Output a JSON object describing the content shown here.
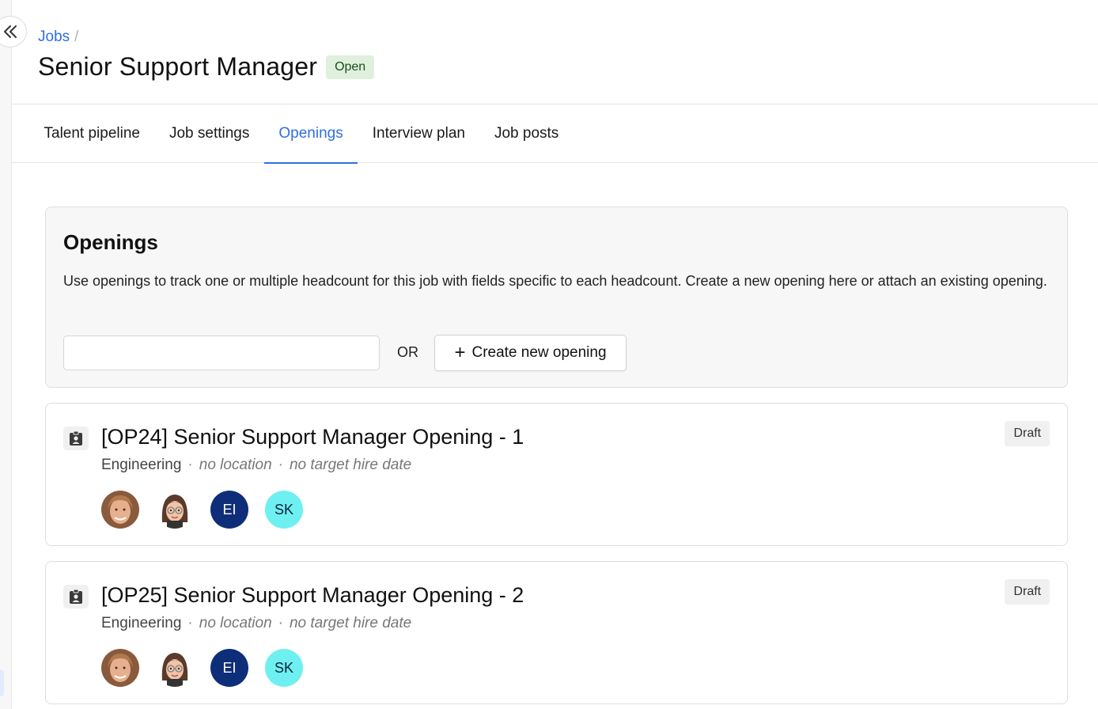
{
  "breadcrumb": {
    "jobs_link": "Jobs",
    "separator": "/"
  },
  "job": {
    "title": "Senior Support Manager",
    "status": "Open"
  },
  "tabs": [
    {
      "label": "Talent pipeline",
      "active": false
    },
    {
      "label": "Job settings",
      "active": false
    },
    {
      "label": "Openings",
      "active": true
    },
    {
      "label": "Interview plan",
      "active": false
    },
    {
      "label": "Job posts",
      "active": false
    }
  ],
  "openings_panel": {
    "title": "Openings",
    "description": "Use openings to track one or multiple headcount for this job with fields specific to each headcount. Create a new opening here or attach an existing opening.",
    "attach_input_value": "",
    "or_label": "OR",
    "create_button_label": "Create new opening"
  },
  "openings": [
    {
      "title": "[OP24] Senior Support Manager Opening - 1",
      "department": "Engineering",
      "location": "no location",
      "target_hire_date": "no target hire date",
      "status": "Draft",
      "people": [
        {
          "type": "photo",
          "name": "person-photo"
        },
        {
          "type": "memoji",
          "name": "memoji"
        },
        {
          "type": "initials",
          "initials": "EI"
        },
        {
          "type": "initials",
          "initials": "SK"
        }
      ]
    },
    {
      "title": "[OP25] Senior Support Manager Opening - 2",
      "department": "Engineering",
      "location": "no location",
      "target_hire_date": "no target hire date",
      "status": "Draft",
      "people": [
        {
          "type": "photo",
          "name": "person-photo"
        },
        {
          "type": "memoji",
          "name": "memoji"
        },
        {
          "type": "initials",
          "initials": "EI"
        },
        {
          "type": "initials",
          "initials": "SK"
        }
      ]
    }
  ],
  "colors": {
    "accent": "#2f6fe0",
    "open_badge_bg": "#dff1dc",
    "initials_ei_bg": "#0f2e7a",
    "initials_sk_bg": "#6ff0f0"
  }
}
